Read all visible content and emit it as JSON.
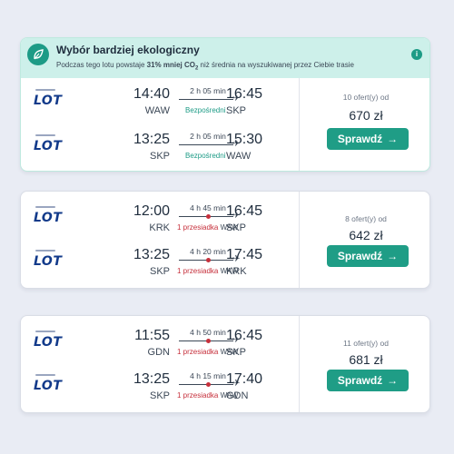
{
  "eco_banner": {
    "title": "Wybór bardziej ekologiczny",
    "text_before": "Podczas tego lotu powstaje ",
    "highlight": "31% mniej CO",
    "subscript": "2",
    "text_after": " niż średnia na wyszukiwanej przez Ciebie trasie",
    "info_icon": "info-icon",
    "leaf_icon": "leaf-icon"
  },
  "cards": [
    {
      "legs": [
        {
          "airline": "LOT",
          "dep_time": "14:40",
          "dep_code": "WAW",
          "arr_time": "16:45",
          "arr_code": "SKP",
          "duration": "2 h 05 min",
          "stops_text": "Bezpośredni",
          "via": ""
        },
        {
          "airline": "LOT",
          "dep_time": "13:25",
          "dep_code": "SKP",
          "arr_time": "15:30",
          "arr_code": "WAW",
          "duration": "2 h 05 min",
          "stops_text": "Bezpośredni",
          "via": ""
        }
      ],
      "offers": "10 ofert(y) od",
      "price": "670 zł",
      "button": "Sprawdź"
    },
    {
      "legs": [
        {
          "airline": "LOT",
          "dep_time": "12:00",
          "dep_code": "KRK",
          "arr_time": "16:45",
          "arr_code": "SKP",
          "duration": "4 h 45 min",
          "stops_text": "1 przesiadka",
          "via": "WAW"
        },
        {
          "airline": "LOT",
          "dep_time": "13:25",
          "dep_code": "SKP",
          "arr_time": "17:45",
          "arr_code": "KRK",
          "duration": "4 h 20 min",
          "stops_text": "1 przesiadka",
          "via": "WAW"
        }
      ],
      "offers": "8 ofert(y) od",
      "price": "642 zł",
      "button": "Sprawdź"
    },
    {
      "legs": [
        {
          "airline": "LOT",
          "dep_time": "11:55",
          "dep_code": "GDN",
          "arr_time": "16:45",
          "arr_code": "SKP",
          "duration": "4 h 50 min",
          "stops_text": "1 przesiadka",
          "via": "WAW"
        },
        {
          "airline": "LOT",
          "dep_time": "13:25",
          "dep_code": "SKP",
          "arr_time": "17:40",
          "arr_code": "GDN",
          "duration": "4 h 15 min",
          "stops_text": "1 przesiadka",
          "via": "WAW"
        }
      ],
      "offers": "11 ofert(y) od",
      "price": "681 zł",
      "button": "Sprawdź"
    }
  ],
  "colors": {
    "accent": "#1f9d86",
    "eco_bg": "#cdf0ea",
    "stop_red": "#c62f3b",
    "lot_blue": "#123a8a"
  }
}
